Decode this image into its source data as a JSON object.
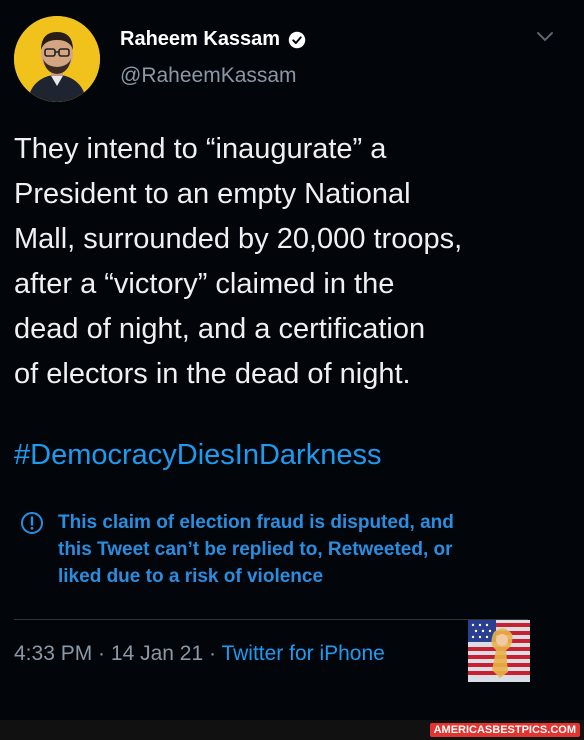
{
  "author": {
    "display_name": "Raheem Kassam",
    "handle": "@RaheemKassam",
    "verified": true
  },
  "tweet": {
    "text": "They intend to “inaugurate” a\nPresident to an empty National\nMall, surrounded by 20,000 troops,\nafter a “victory” claimed in the\ndead of night, and a certification\nof electors in the dead of night.",
    "hashtag": "#DemocracyDiesInDarkness"
  },
  "notice": {
    "text": "This claim of election fraud is disputed, and\nthis Tweet can’t be replied to, Retweeted, or\nliked due to a risk of violence"
  },
  "meta": {
    "time": "4:33 PM",
    "sep1": " · ",
    "date": "14 Jan 21",
    "sep2": " · ",
    "source": "Twitter for iPhone"
  },
  "watermark": "AMERICASBESTPICS.COM",
  "colors": {
    "background": "#02050a",
    "link_blue": "#1d9bf0",
    "notice_blue": "#2a8ee0",
    "muted": "#8b98a5",
    "avatar_bg": "#f1c21b",
    "watermark_red": "#e3342f"
  },
  "icons": [
    "verified-badge-icon",
    "chevron-down-icon",
    "exclamation-circle-icon"
  ]
}
